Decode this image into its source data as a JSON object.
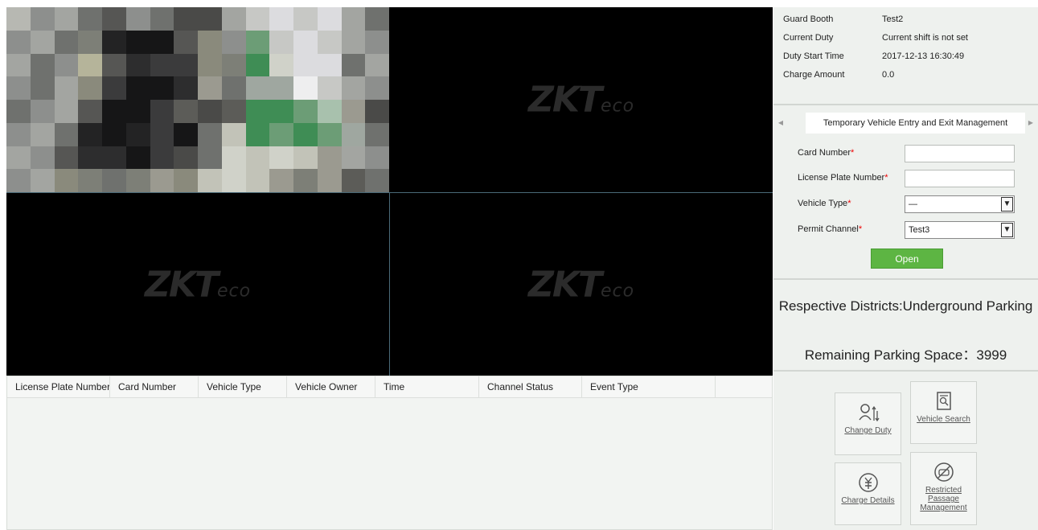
{
  "video_grid": {
    "logo_text_main": "ZKT",
    "logo_text_suffix": "eco"
  },
  "records_table": {
    "columns": [
      "License Plate Number",
      "Card Number",
      "Vehicle Type",
      "Vehicle Owner",
      "Time",
      "Channel Status",
      "Event Type",
      ""
    ]
  },
  "duty_info": {
    "guard_booth_label": "Guard Booth",
    "guard_booth_value": "Test2",
    "current_duty_label": "Current Duty",
    "current_duty_value": "Current shift is not set",
    "duty_start_label": "Duty Start Time",
    "duty_start_value": "2017-12-13 16:30:49",
    "charge_amount_label": "Charge Amount",
    "charge_amount_value": "0.0"
  },
  "entry_form": {
    "tab_label": "Temporary Vehicle Entry and Exit Management",
    "card_number_label": "Card Number",
    "card_number_value": "",
    "license_plate_label": "License Plate Number",
    "license_plate_value": "",
    "vehicle_type_label": "Vehicle Type",
    "vehicle_type_value": "—",
    "permit_channel_label": "Permit Channel",
    "permit_channel_value": "Test3",
    "required_mark": "*",
    "open_label": "Open"
  },
  "district": {
    "districts_text": "Respective Districts:Underground Parking",
    "remaining_text": "Remaining Parking Space：3999"
  },
  "actions": {
    "change_duty_label": "Change Duty",
    "vehicle_search_label": "Vehicle Search",
    "charge_details_label": "Charge Details",
    "restricted_passage_label": "Restricted Passage Management"
  }
}
